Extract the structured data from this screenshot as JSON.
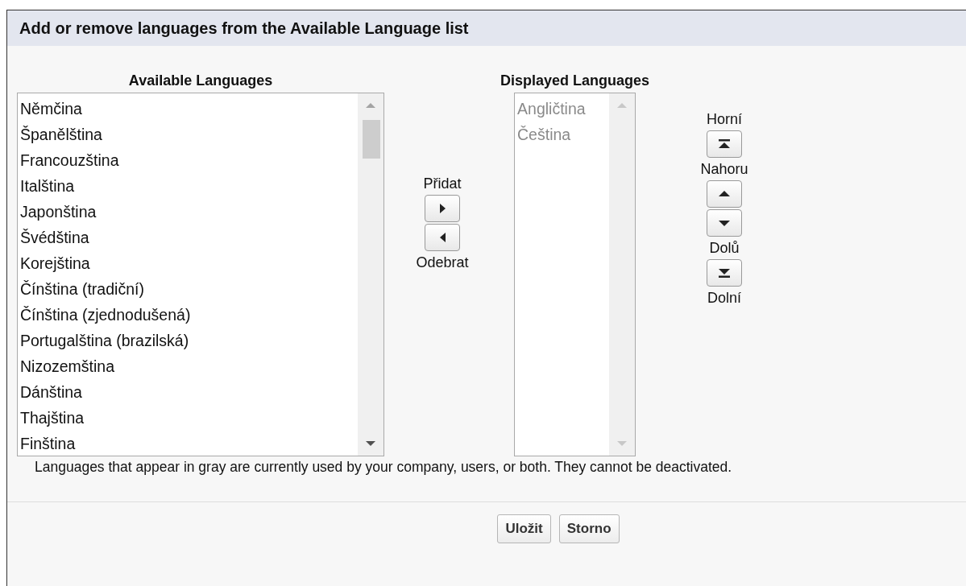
{
  "dialog": {
    "title": "Add or remove languages from the Available Language list"
  },
  "available": {
    "heading": "Available Languages",
    "items": [
      {
        "label": "Němčina",
        "grayed": false
      },
      {
        "label": "Španělština",
        "grayed": false
      },
      {
        "label": "Francouzština",
        "grayed": false
      },
      {
        "label": "Italština",
        "grayed": false
      },
      {
        "label": "Japonština",
        "grayed": false
      },
      {
        "label": "Švédština",
        "grayed": false
      },
      {
        "label": "Korejština",
        "grayed": false
      },
      {
        "label": "Čínština (tradiční)",
        "grayed": false
      },
      {
        "label": "Čínština (zjednodušená)",
        "grayed": false
      },
      {
        "label": "Portugalština (brazilská)",
        "grayed": false
      },
      {
        "label": "Nizozemština",
        "grayed": false
      },
      {
        "label": "Dánština",
        "grayed": false
      },
      {
        "label": "Thajština",
        "grayed": false
      },
      {
        "label": "Finština",
        "grayed": false
      }
    ]
  },
  "transfer": {
    "add_label": "Přidat",
    "remove_label": "Odebrat"
  },
  "displayed": {
    "heading": "Displayed Languages",
    "items": [
      {
        "label": "Angličtina",
        "grayed": true
      },
      {
        "label": "Čeština",
        "grayed": true
      }
    ]
  },
  "order": [
    {
      "kind": "top",
      "label": "Horní"
    },
    {
      "kind": "up",
      "label": "Nahoru"
    },
    {
      "kind": "down",
      "label": "Dolů"
    },
    {
      "kind": "bottom",
      "label": "Dolní"
    }
  ],
  "note": "Languages that appear in gray are currently used by your company, users, or both. They cannot be deactivated.",
  "buttons": [
    "Uložit",
    "Storno"
  ]
}
